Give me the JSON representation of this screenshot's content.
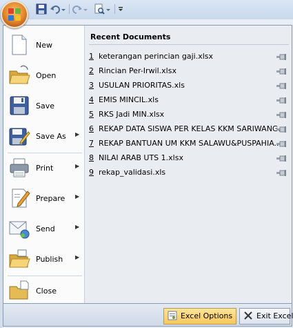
{
  "menu": {
    "new": "New",
    "open": "Open",
    "save": "Save",
    "save_as": "Save As",
    "print": "Print",
    "prepare": "Prepare",
    "send": "Send",
    "publish": "Publish",
    "close": "Close"
  },
  "recent": {
    "title": "Recent Documents",
    "docs": [
      {
        "num": "1",
        "name": "keterangan perincian gaji.xlsx"
      },
      {
        "num": "2",
        "name": "Rincian Per-Irwil.xlsx"
      },
      {
        "num": "3",
        "name": "USULAN PRIORITAS.xls"
      },
      {
        "num": "4",
        "name": "EMIS MINCIL.xls"
      },
      {
        "num": "5",
        "name": "RKS Jadi MIN.xlsx"
      },
      {
        "num": "6",
        "name": "REKAP DATA SISWA PER KELAS KKM SARIWANG..."
      },
      {
        "num": "7",
        "name": "REKAP BANTUAN UM KKM SALAWU&PUSPAHIA..."
      },
      {
        "num": "8",
        "name": "NILAI ARAB UTS 1.xlsx"
      },
      {
        "num": "9",
        "name": "rekap_validasi.xls"
      }
    ]
  },
  "bottom": {
    "options": "Excel Options",
    "exit": "Exit Excel"
  }
}
